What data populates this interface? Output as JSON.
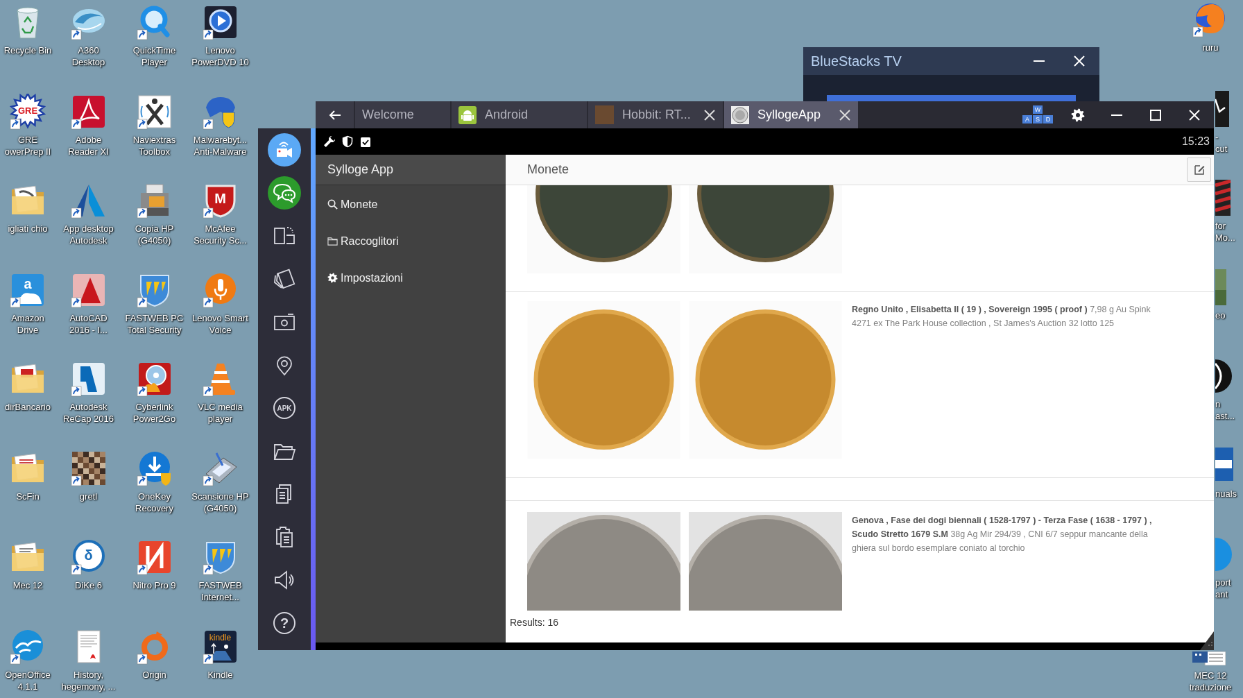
{
  "desktop": {
    "icons_left": [
      {
        "label": "Recycle Bin"
      },
      {
        "label": "GRE\nowerPrep II",
        "logo_text": "GRE"
      },
      {
        "label": "igliati chio"
      },
      {
        "label": "Amazon\nDrive",
        "logo_text": "a"
      },
      {
        "label": "dirBancario"
      },
      {
        "label": "ScFin"
      },
      {
        "label": "Mec 12"
      },
      {
        "label": "OpenOffice\n4.1.1"
      },
      {
        "label": "A360\nDesktop"
      },
      {
        "label": "Adobe\nReader XI"
      },
      {
        "label": "App desktop\nAutodesk"
      },
      {
        "label": "AutoCAD\n2016 - I..."
      },
      {
        "label": "Autodesk\nReCap 2016"
      },
      {
        "label": "gretl"
      },
      {
        "label": "DiKe 6",
        "logo_text": "δ"
      },
      {
        "label": "History,\nhegemony, ..."
      },
      {
        "label": "QuickTime\nPlayer"
      },
      {
        "label": "Naviextras\nToolbox"
      },
      {
        "label": "Copia HP\n(G4050)"
      },
      {
        "label": "FASTWEB PC\nTotal Security"
      },
      {
        "label": "Cyberlink\nPower2Go"
      },
      {
        "label": "OneKey\nRecovery"
      },
      {
        "label": "Nitro Pro 9"
      },
      {
        "label": "Origin"
      },
      {
        "label": "Lenovo\nPowerDVD 10"
      },
      {
        "label": "Malwarebyt...\nAnti-Malware"
      },
      {
        "label": "McAfee\nSecurity Sc...",
        "logo_text": "M"
      },
      {
        "label": "Lenovo Smart\nVoice"
      },
      {
        "label": "VLC media\nplayer"
      },
      {
        "label": "Scansione HP\n(G4050)"
      },
      {
        "label": "FASTWEB\nInternet..."
      },
      {
        "label": "Kindle",
        "logo_text": "kindle"
      }
    ],
    "icons_right": [
      {
        "label": "ruru",
        "kind": "full"
      },
      {
        "label": "-\ncut",
        "kind": "partial"
      },
      {
        "label": "for\nMo...",
        "kind": "partial"
      },
      {
        "label": "eo",
        "kind": "partial"
      },
      {
        "label": "n\nast...",
        "kind": "partial"
      },
      {
        "label": "nuals",
        "kind": "partial"
      },
      {
        "label": "port\nant",
        "kind": "partial"
      },
      {
        "label": "MEC 12\ntraduzione",
        "kind": "covered"
      }
    ]
  },
  "tv_window": {
    "title": "BlueStacks TV"
  },
  "bluestacks": {
    "sidebar": {
      "apk_label": "APK",
      "help_label": "?"
    },
    "tabs": [
      {
        "label": "Welcome",
        "kind": "home",
        "selected": false,
        "closable": false
      },
      {
        "label": "Android",
        "kind": "android",
        "selected": false,
        "closable": false
      },
      {
        "label": "Hobbit: RT...",
        "kind": "game",
        "selected": false,
        "closable": true
      },
      {
        "label": "SyllogeApp",
        "kind": "app",
        "selected": true,
        "closable": true
      }
    ],
    "keyboard_keys": [
      "W",
      "A",
      "S",
      "D"
    ],
    "status_bar": {
      "time": "15:23"
    }
  },
  "app": {
    "drawer": {
      "title": "Sylloge App",
      "items": [
        {
          "label": "Monete",
          "kind": "search"
        },
        {
          "label": "Raccoglitori",
          "kind": "folder"
        },
        {
          "label": "Impostazioni",
          "kind": "settings"
        }
      ]
    },
    "page_title": "Monete",
    "coins": [
      {
        "kind": "bronze"
      },
      {
        "kind": "gold",
        "description": "**Regno Unito , Elisabetta II ( 19 ) , Sovereign 1995 ( proof )** 7,98 g Au Spink 4271 ex The Park House collection , St James's Auction 32 lotto 125"
      },
      {
        "kind": "silver",
        "description": "**Genova , Fase dei dogi biennali ( 1528-1797 ) - Terza Fase ( 1638 - 1797 ) , Scudo Stretto 1679 S.M** 38g Ag Mir 294/39 , CNI 6/7 seppur mancante della ghiera sul bordo esemplare coniato al torchio"
      }
    ],
    "results": "Results: 16"
  }
}
